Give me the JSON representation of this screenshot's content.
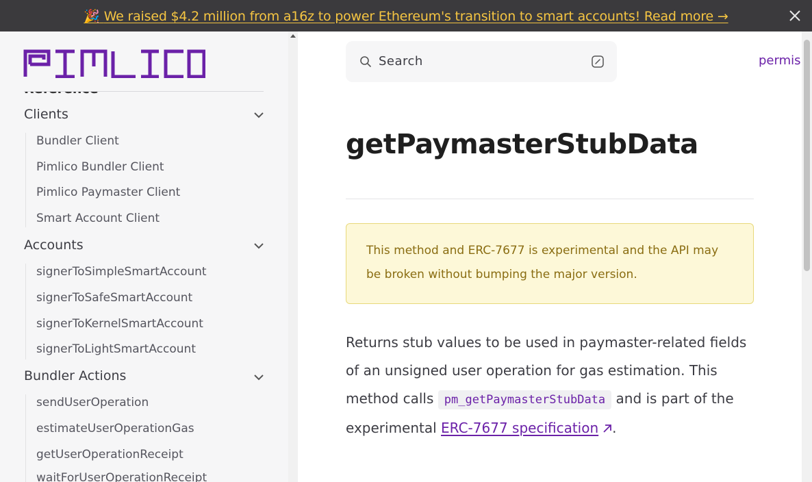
{
  "banner": {
    "emoji": "🎉",
    "text": "We raised $4.2 million from a16z to power Ethereum's transition to smart accounts! Read more →",
    "close_icon": "close-icon"
  },
  "sidebar": {
    "logo_text": "PIMLICO",
    "cut_heading": "Reference",
    "groups": [
      {
        "title": "Clients",
        "items": [
          "Bundler Client",
          "Pimlico Bundler Client",
          "Pimlico Paymaster Client",
          "Smart Account Client"
        ]
      },
      {
        "title": "Accounts",
        "items": [
          "signerToSimpleSmartAccount",
          "signerToSafeSmartAccount",
          "signerToKernelSmartAccount",
          "signerToLightSmartAccount"
        ]
      },
      {
        "title": "Bundler Actions",
        "items": [
          "sendUserOperation",
          "estimateUserOperationGas",
          "getUserOperationReceipt",
          "waitForUserOperationReceipt"
        ]
      }
    ]
  },
  "search": {
    "placeholder": "Search"
  },
  "nav": {
    "permissionless": "permis"
  },
  "main": {
    "title": "getPaymasterStubData",
    "warning": "This method and ERC-7677 is experimental and the API may be broken without bumping the major version.",
    "para_1": "Returns stub values to be used in paymaster-related fields of an unsigned user operation for gas estimation. This method calls ",
    "code": "pm_getPaymasterStubData",
    "para_2": " and is part of the experimental ",
    "link": "ERC-7677 specification",
    "para_3": "."
  },
  "colors": {
    "accent": "#6b21a8",
    "banner_bg": "#3b3a3d",
    "banner_text": "#f5c542",
    "warning_bg": "#fdf8d8",
    "warning_text": "#8a6d12"
  }
}
